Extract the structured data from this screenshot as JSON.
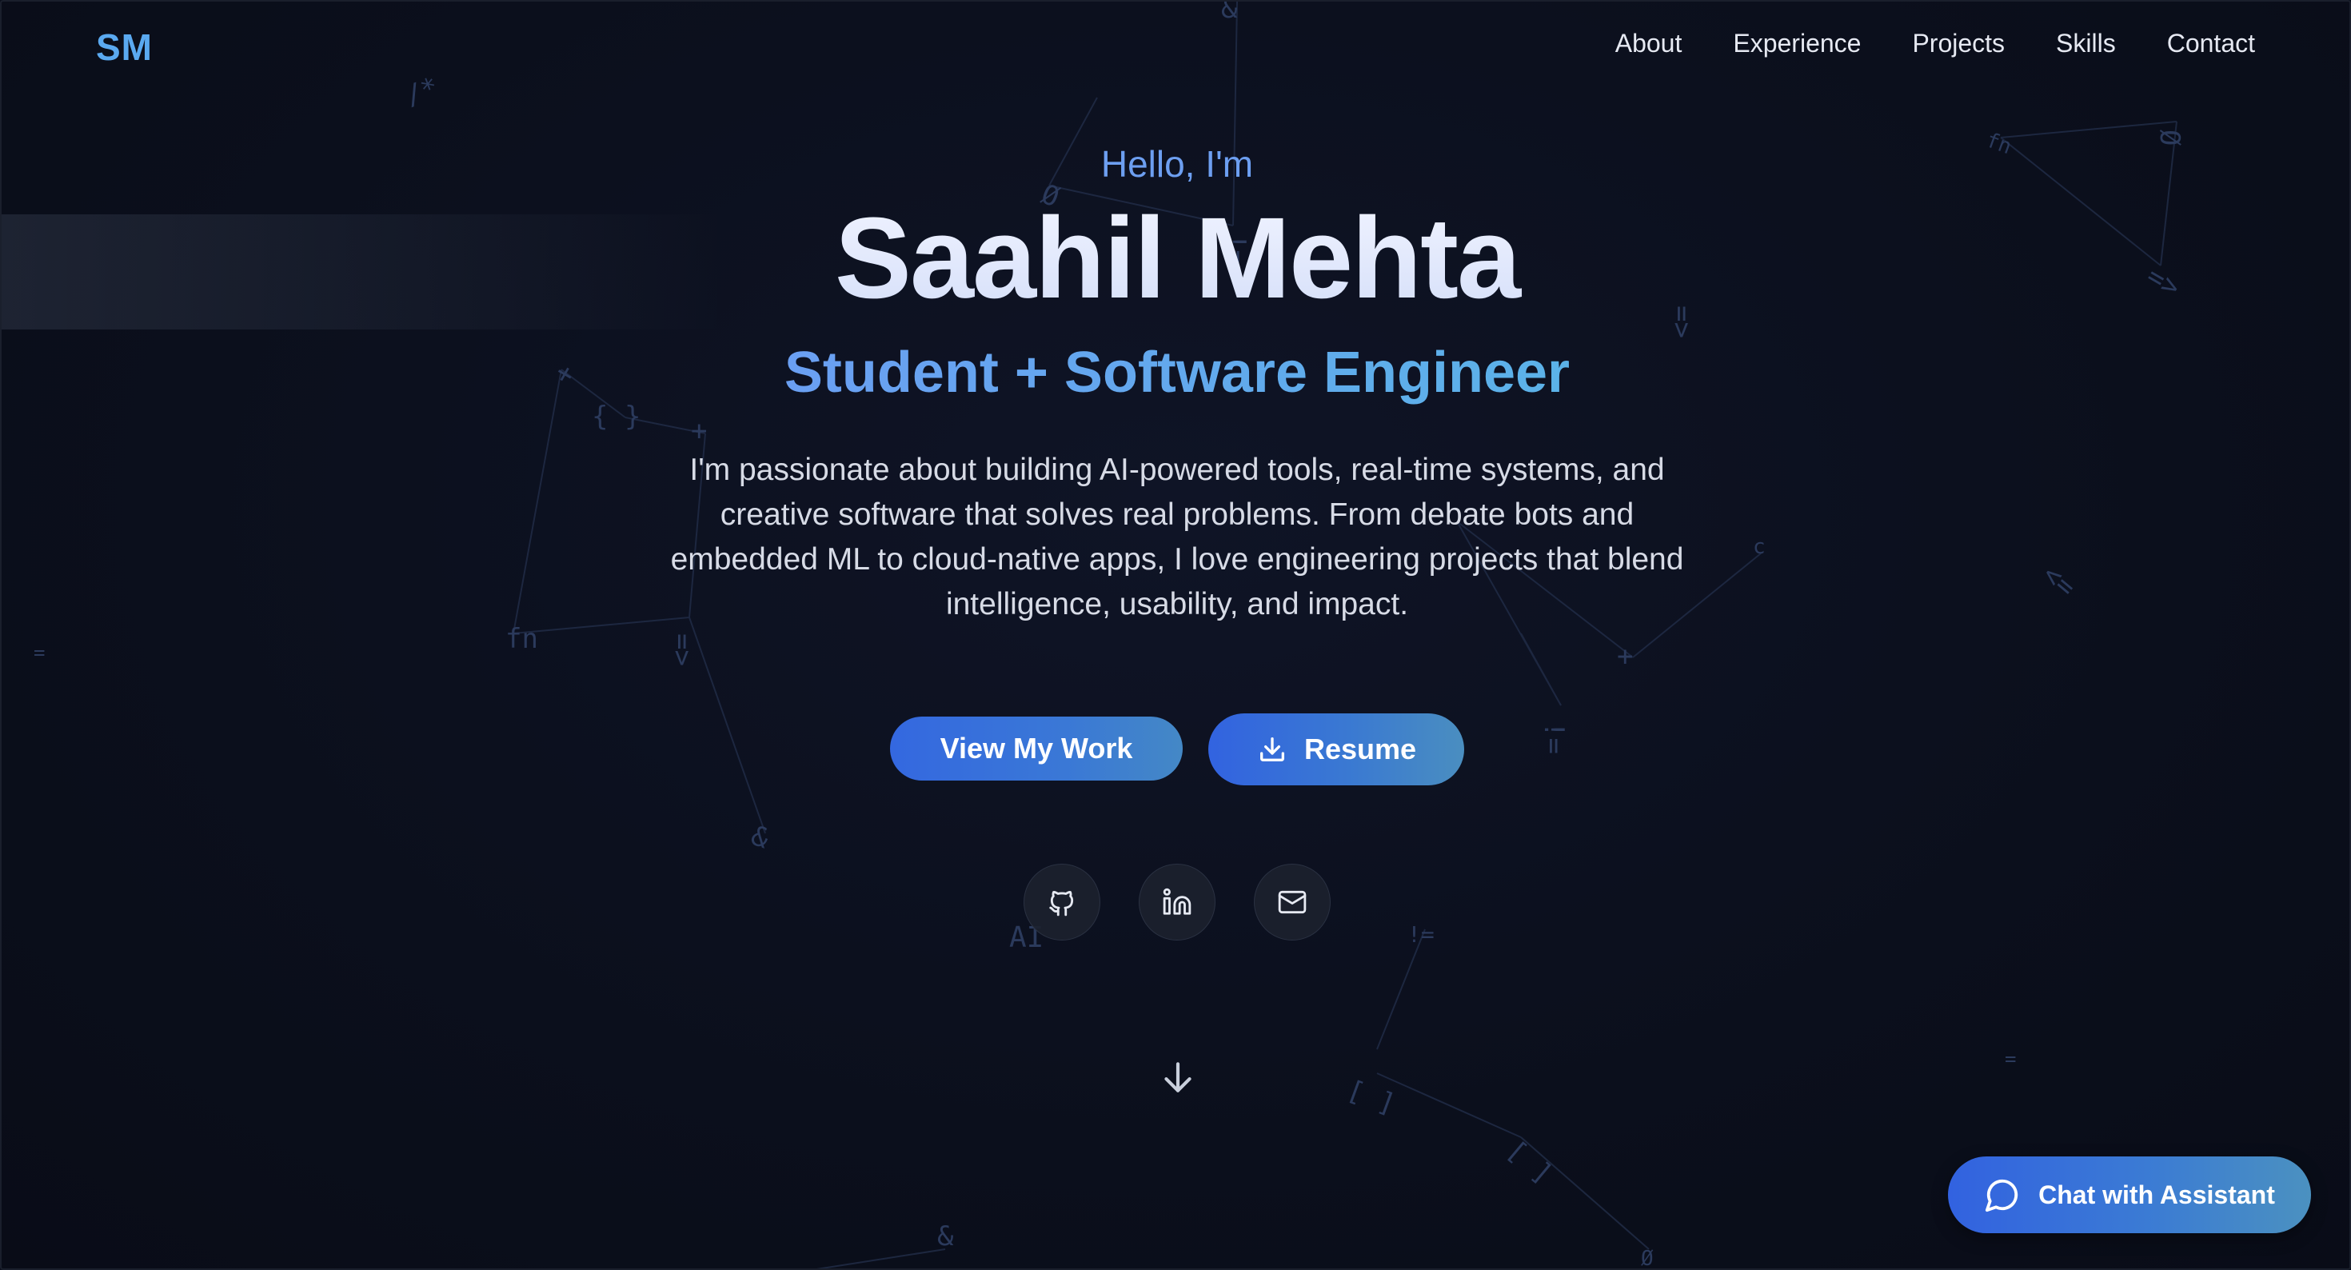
{
  "nav": {
    "logo": "SM",
    "links": [
      "About",
      "Experience",
      "Projects",
      "Skills",
      "Contact"
    ]
  },
  "hero": {
    "greeting": "Hello, I'm",
    "name": "Saahil Mehta",
    "role": "Student + Software Engineer",
    "bio": "I'm passionate about building AI-powered tools, real-time systems, and creative software that solves real problems. From debate bots and embedded ML to cloud-native apps, I love engineering projects that blend intelligence, usability, and impact.",
    "primary_button": "View My Work",
    "resume_button": "Resume",
    "socials": [
      "github-icon",
      "linkedin-icon",
      "mail-icon"
    ]
  },
  "chat": {
    "label": "Chat with Assistant"
  },
  "colors": {
    "background": "#0b0f1c",
    "accent": "#3a6fe0",
    "logo": "#5aa9f0",
    "greeting": "#6d9ff1"
  }
}
